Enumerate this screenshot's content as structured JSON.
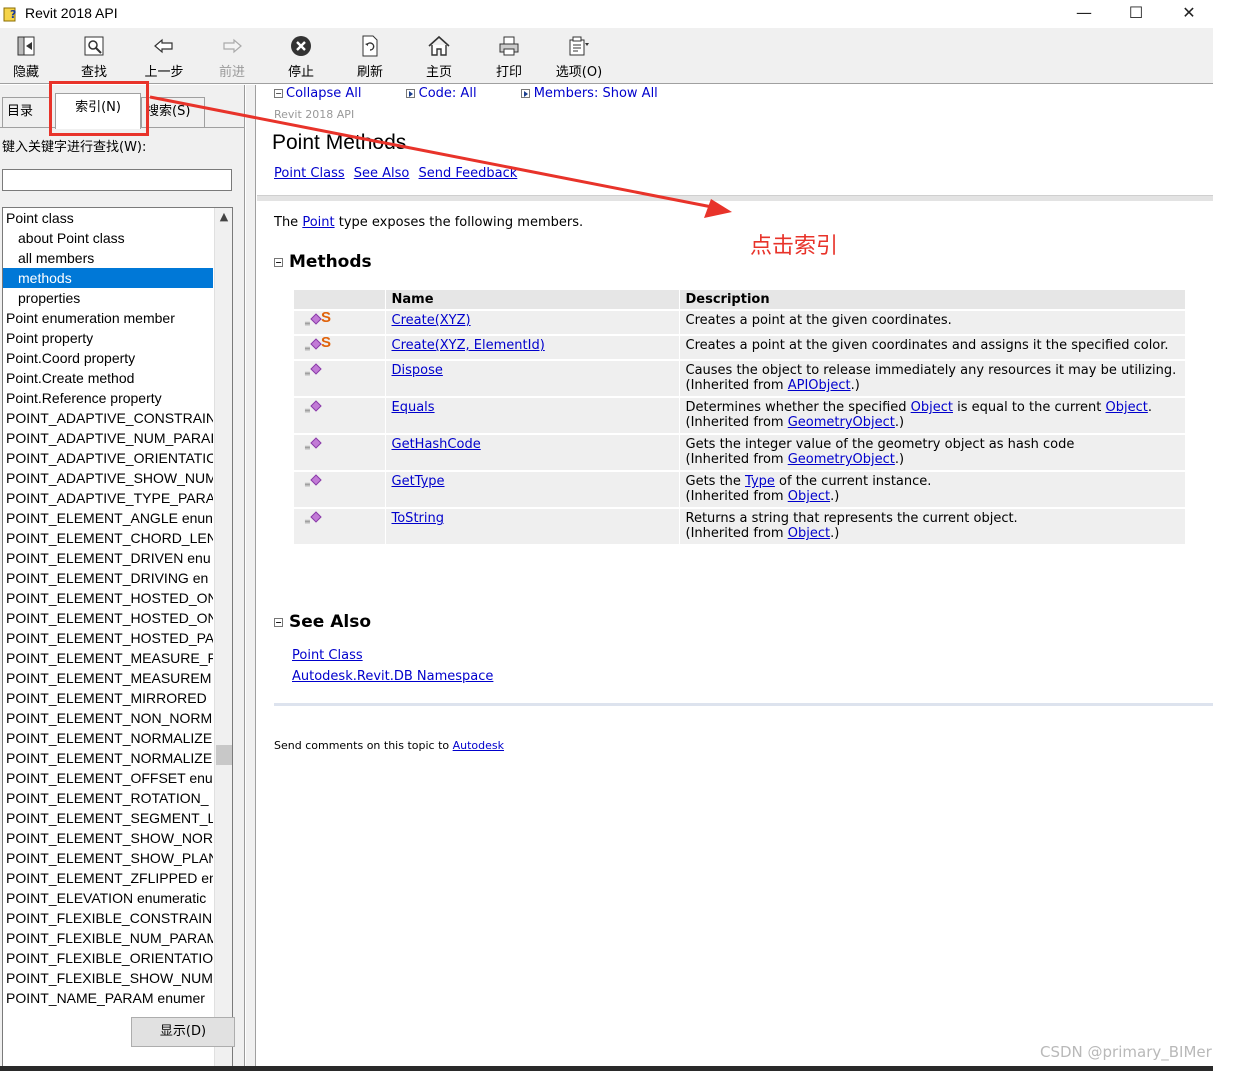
{
  "window": {
    "title": "Revit 2018 API",
    "minimize": "—",
    "maximize": "☐",
    "close": "✕"
  },
  "toolbar": [
    {
      "label": "隐藏",
      "icon": "hide-pane-icon"
    },
    {
      "label": "查找",
      "icon": "find-icon"
    },
    {
      "label": "上一步",
      "icon": "back-arrow-icon"
    },
    {
      "label": "前进",
      "icon": "forward-arrow-icon",
      "disabled": true
    },
    {
      "label": "停止",
      "icon": "stop-icon"
    },
    {
      "label": "刷新",
      "icon": "refresh-icon"
    },
    {
      "label": "主页",
      "icon": "home-icon"
    },
    {
      "label": "打印",
      "icon": "print-icon"
    },
    {
      "label": "选项(O)",
      "icon": "options-icon"
    }
  ],
  "nav": {
    "tabs": [
      "目录(C",
      "索引(N)",
      "搜索(S)"
    ],
    "active_tab": "索引(N)",
    "keyword_label": "键入关键字进行查找(W):",
    "keyword_value": "",
    "display_button": "显示(D)",
    "index_items": [
      {
        "text": "Point class",
        "level": 0
      },
      {
        "text": "about Point class",
        "level": 1
      },
      {
        "text": "all members",
        "level": 1
      },
      {
        "text": "methods",
        "level": 1,
        "selected": true
      },
      {
        "text": "properties",
        "level": 1
      },
      {
        "text": "Point enumeration member",
        "level": 0
      },
      {
        "text": "Point property",
        "level": 0
      },
      {
        "text": "Point.Coord property",
        "level": 0
      },
      {
        "text": "Point.Create method",
        "level": 0
      },
      {
        "text": "Point.Reference property",
        "level": 0
      },
      {
        "text": "POINT_ADAPTIVE_CONSTRAIN",
        "level": 0
      },
      {
        "text": "POINT_ADAPTIVE_NUM_PARAI",
        "level": 0
      },
      {
        "text": "POINT_ADAPTIVE_ORIENTATIC",
        "level": 0
      },
      {
        "text": "POINT_ADAPTIVE_SHOW_NUM",
        "level": 0
      },
      {
        "text": "POINT_ADAPTIVE_TYPE_PARAM",
        "level": 0
      },
      {
        "text": "POINT_ELEMENT_ANGLE enun",
        "level": 0
      },
      {
        "text": "POINT_ELEMENT_CHORD_LEN",
        "level": 0
      },
      {
        "text": "POINT_ELEMENT_DRIVEN enu",
        "level": 0
      },
      {
        "text": "POINT_ELEMENT_DRIVING en",
        "level": 0
      },
      {
        "text": "POINT_ELEMENT_HOSTED_ON",
        "level": 0
      },
      {
        "text": "POINT_ELEMENT_HOSTED_ON",
        "level": 0
      },
      {
        "text": "POINT_ELEMENT_HOSTED_PAI",
        "level": 0
      },
      {
        "text": "POINT_ELEMENT_MEASURE_FI",
        "level": 0
      },
      {
        "text": "POINT_ELEMENT_MEASUREM",
        "level": 0
      },
      {
        "text": "POINT_ELEMENT_MIRRORED",
        "level": 0
      },
      {
        "text": "POINT_ELEMENT_NON_NORM",
        "level": 0
      },
      {
        "text": "POINT_ELEMENT_NORMALIZE",
        "level": 0
      },
      {
        "text": "POINT_ELEMENT_NORMALIZE",
        "level": 0
      },
      {
        "text": "POINT_ELEMENT_OFFSET enur",
        "level": 0
      },
      {
        "text": "POINT_ELEMENT_ROTATION_",
        "level": 0
      },
      {
        "text": "POINT_ELEMENT_SEGMENT_L",
        "level": 0
      },
      {
        "text": "POINT_ELEMENT_SHOW_NOR",
        "level": 0
      },
      {
        "text": "POINT_ELEMENT_SHOW_PLAN",
        "level": 0
      },
      {
        "text": "POINT_ELEMENT_ZFLIPPED en",
        "level": 0
      },
      {
        "text": "POINT_ELEVATION enumeratic",
        "level": 0
      },
      {
        "text": "POINT_FLEXIBLE_CONSTRAINI",
        "level": 0
      },
      {
        "text": "POINT_FLEXIBLE_NUM_PARAM",
        "level": 0
      },
      {
        "text": "POINT_FLEXIBLE_ORIENTATIO",
        "level": 0
      },
      {
        "text": "POINT_FLEXIBLE_SHOW_NUM",
        "level": 0
      },
      {
        "text": "POINT_NAME_PARAM enumer",
        "level": 0
      }
    ]
  },
  "doc": {
    "collapse_all": "Collapse All",
    "code_all": "Code: All",
    "members_show_all": "Members: Show All",
    "running_head": "Revit 2018 API",
    "title": "Point Methods",
    "links": [
      "Point Class",
      "See Also",
      "Send Feedback"
    ],
    "intro_pre": "The ",
    "intro_link": "Point",
    "intro_post": " type exposes the following members.",
    "methods_heading": "Methods",
    "columns": [
      "",
      "Name",
      "Description"
    ],
    "methods": [
      {
        "name": "Create(XYZ)",
        "static": true,
        "desc": [
          {
            "t": "Creates a point at the given coordinates."
          }
        ]
      },
      {
        "name": "Create(XYZ, ElementId)",
        "static": true,
        "desc": [
          {
            "t": "Creates a point at the given coordinates and assigns it the specified color."
          }
        ]
      },
      {
        "name": "Dispose",
        "static": false,
        "desc": [
          {
            "t": "Causes the object to release immediately any resources it may be utilizing."
          },
          {
            "br": true
          },
          {
            "t": "(Inherited from "
          },
          {
            "link": "APIObject"
          },
          {
            "t": ".)"
          }
        ]
      },
      {
        "name": "Equals",
        "static": false,
        "desc": [
          {
            "t": "Determines whether the specified "
          },
          {
            "link": "Object"
          },
          {
            "t": " is equal to the current "
          },
          {
            "link": "Object"
          },
          {
            "t": "."
          },
          {
            "br": true
          },
          {
            "t": "(Inherited from "
          },
          {
            "link": "GeometryObject"
          },
          {
            "t": ".)"
          }
        ]
      },
      {
        "name": "GetHashCode",
        "static": false,
        "desc": [
          {
            "t": "Gets the integer value of the geometry object as hash code"
          },
          {
            "br": true
          },
          {
            "t": "(Inherited from "
          },
          {
            "link": "GeometryObject"
          },
          {
            "t": ".)"
          }
        ]
      },
      {
        "name": "GetType",
        "static": false,
        "desc": [
          {
            "t": "Gets the "
          },
          {
            "link": "Type"
          },
          {
            "t": " of the current instance."
          },
          {
            "br": true
          },
          {
            "t": "(Inherited from "
          },
          {
            "link": "Object"
          },
          {
            "t": ".)"
          }
        ]
      },
      {
        "name": "ToString",
        "static": false,
        "desc": [
          {
            "t": "Returns a string that represents the current object."
          },
          {
            "br": true
          },
          {
            "t": "(Inherited from "
          },
          {
            "link": "Object"
          },
          {
            "t": ".)"
          }
        ]
      }
    ],
    "see_also_heading": "See Also",
    "see_also_links": [
      "Point Class",
      "Autodesk.Revit.DB Namespace"
    ],
    "footer_text": "Send comments on this topic to ",
    "footer_link": "Autodesk"
  },
  "annotation": {
    "text": "点击索引",
    "color": "#e8332a"
  },
  "watermark": "CSDN @primary_BIMer",
  "colors": {
    "link": "#0000cc",
    "selection": "#0078d7",
    "static_marker": "#e0620a",
    "method_gem": "#c27bd6"
  }
}
